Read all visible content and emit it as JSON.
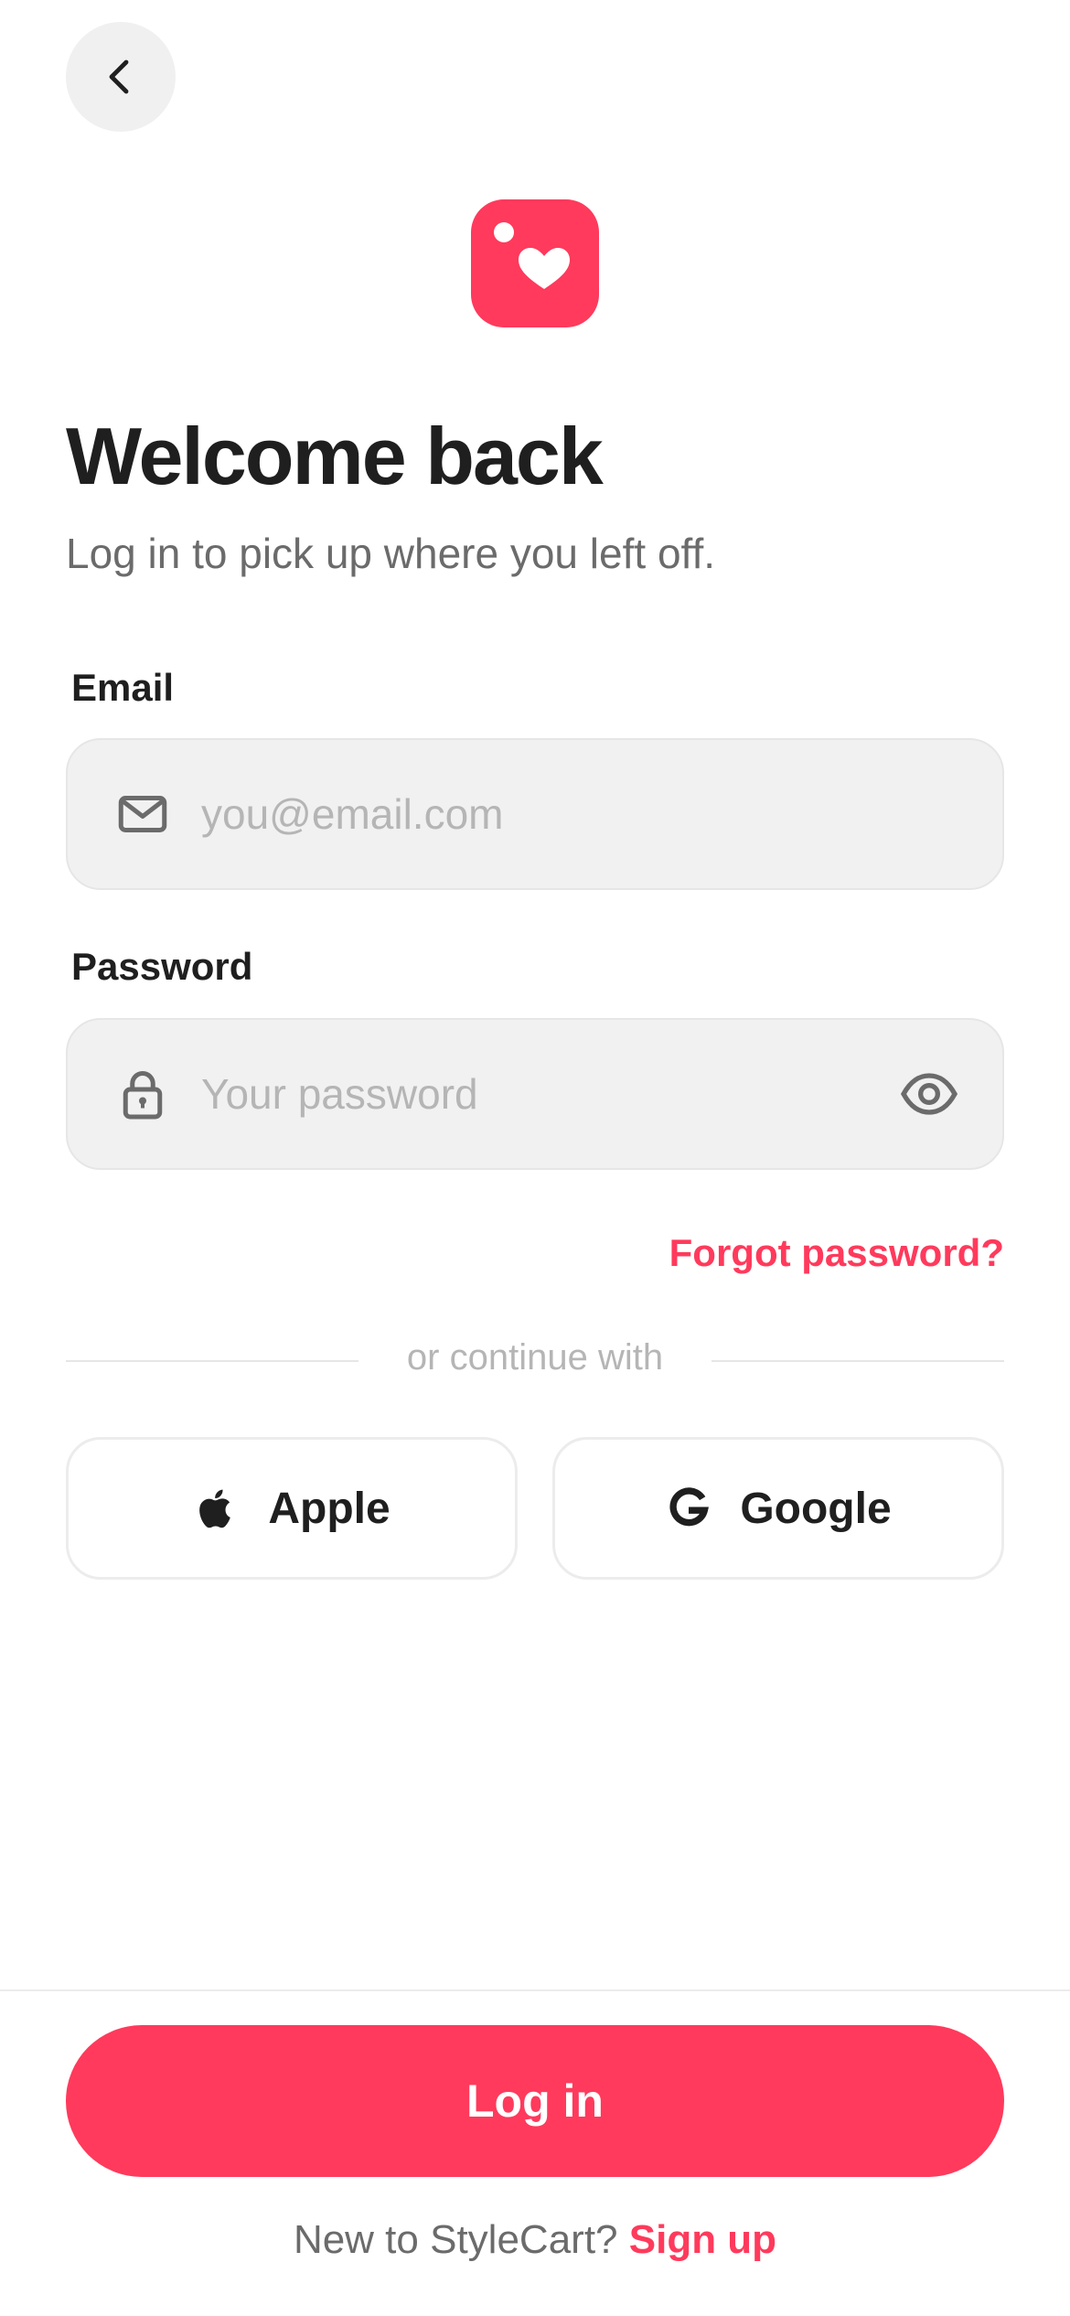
{
  "header": {
    "back_icon": "chevron-left-icon",
    "logo_icon": "heart-bag-logo"
  },
  "intro": {
    "title": "Welcome back",
    "subtitle": "Log in to pick up where you left off."
  },
  "form": {
    "email": {
      "label": "Email",
      "placeholder": "you@email.com",
      "value": "",
      "icon": "mail-icon"
    },
    "password": {
      "label": "Password",
      "placeholder": "Your password",
      "value": "",
      "icon": "lock-icon",
      "toggle_icon": "eye-icon"
    },
    "forgot_label": "Forgot password?"
  },
  "social": {
    "divider_text": "or continue with",
    "apple_label": "Apple",
    "google_label": "Google"
  },
  "footer": {
    "login_label": "Log in",
    "signup_prompt": "New to StyleCart?",
    "signup_link": "Sign up"
  },
  "colors": {
    "accent": "#ff3a5c",
    "text_primary": "#1f1f1f",
    "text_secondary": "#6b6b6b",
    "placeholder": "#b5b5b5",
    "field_bg": "#f1f1f1"
  }
}
